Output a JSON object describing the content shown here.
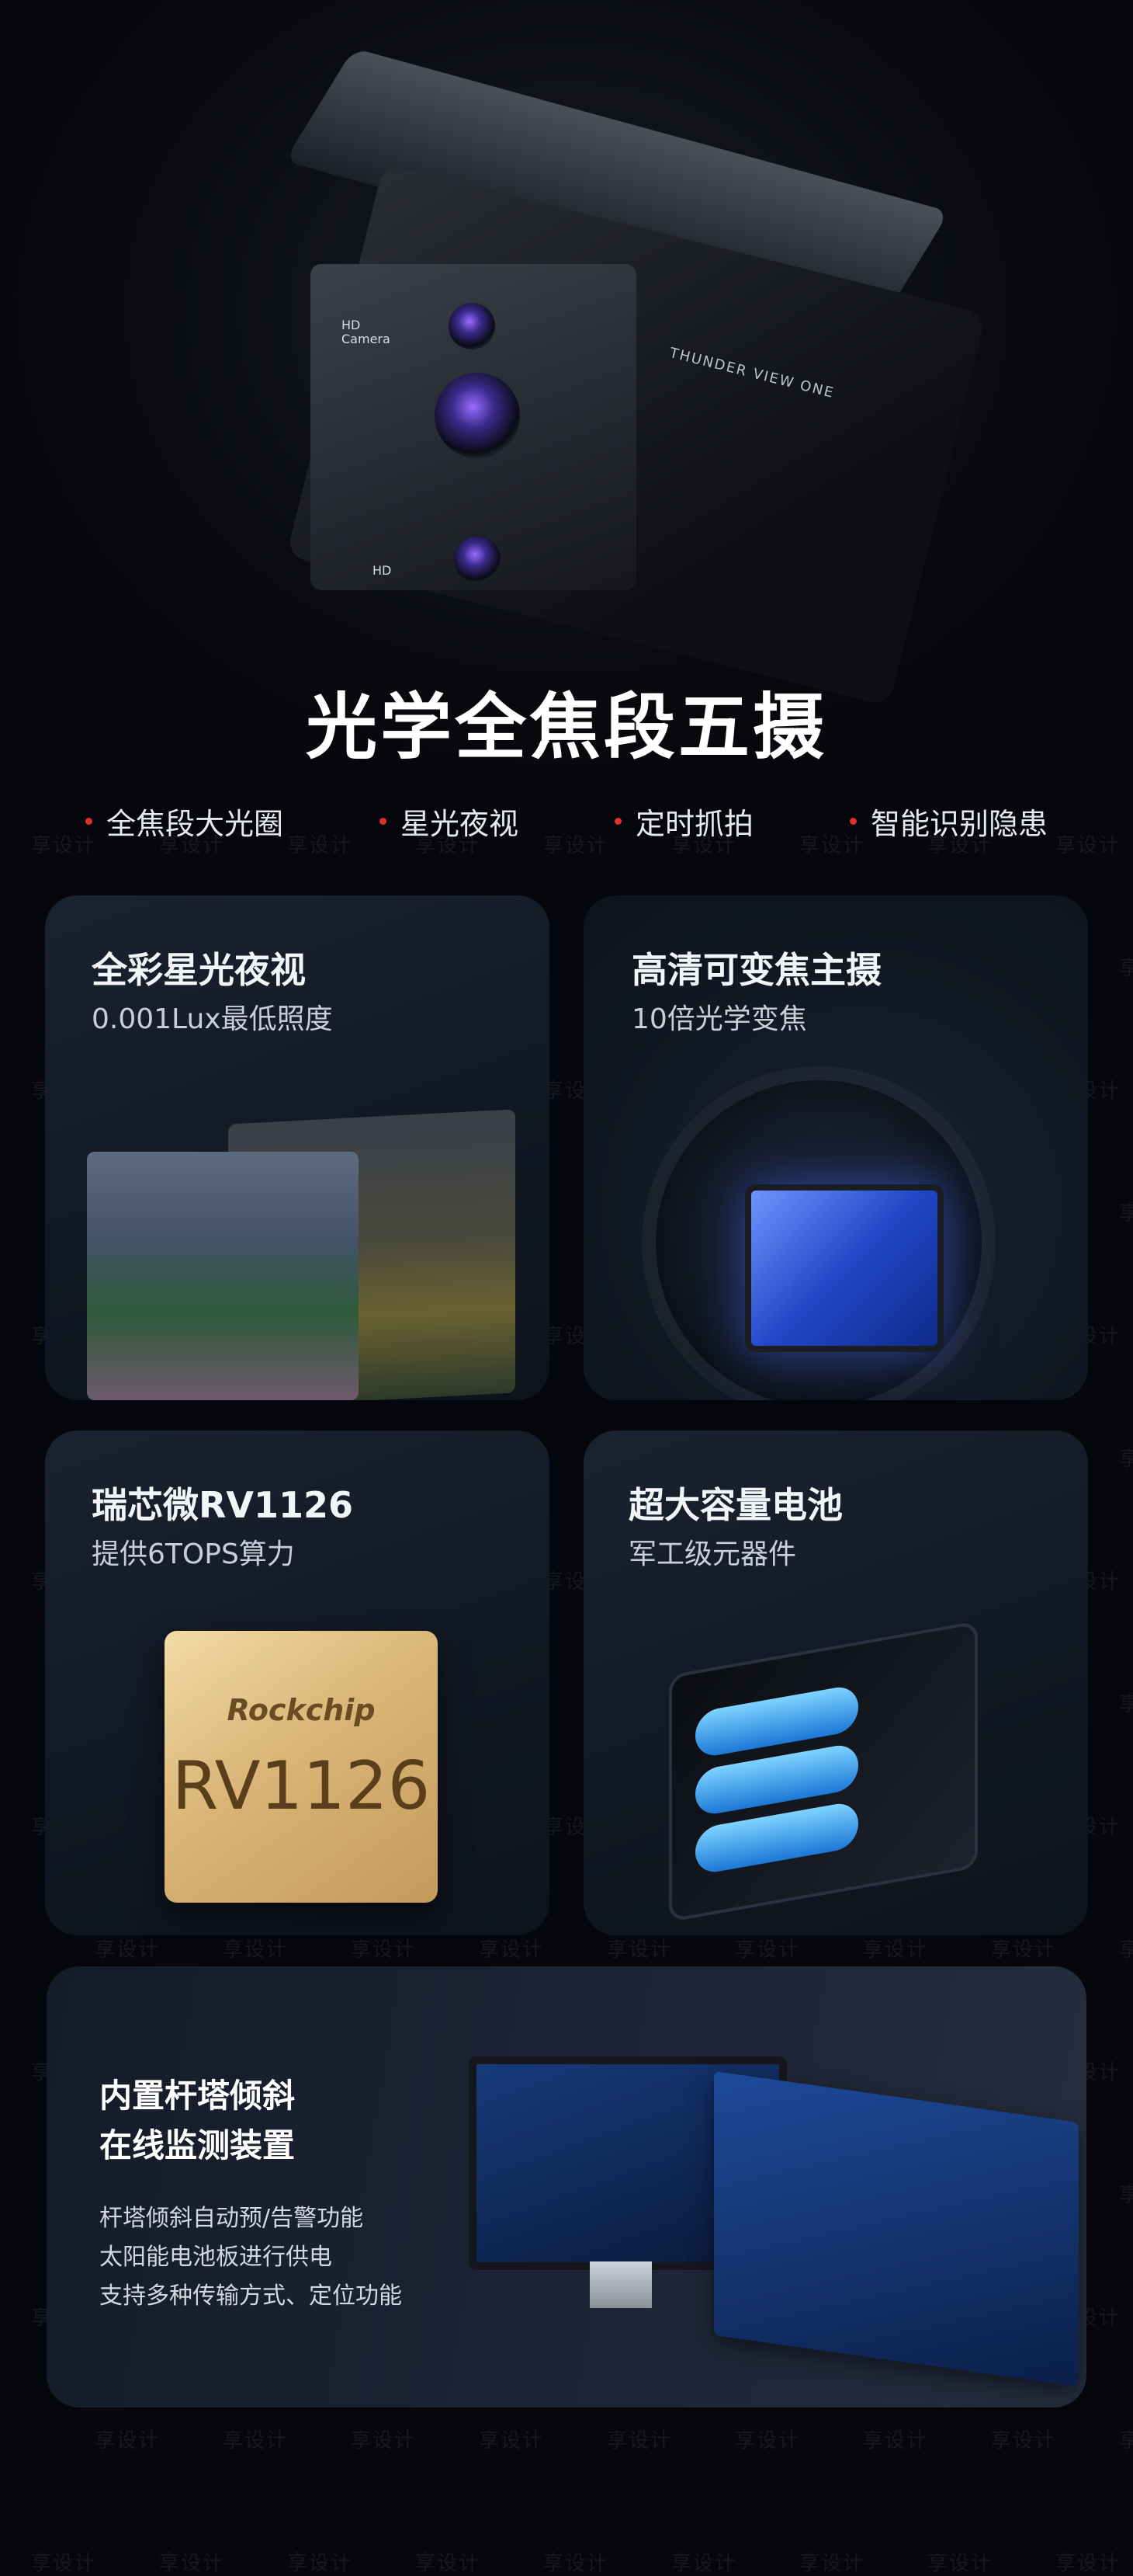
{
  "hero": {
    "title": "光学全焦段五摄",
    "camera_text_hd_top": "HD Camera",
    "camera_text_hd_bottom": "HD",
    "camera_text_brand": "THUNDER VIEW ONE"
  },
  "features": [
    {
      "label": "全焦段大光圈"
    },
    {
      "label": "星光夜视"
    },
    {
      "label": "定时抓拍"
    },
    {
      "label": "智能识别隐患"
    }
  ],
  "cards": {
    "night_vision": {
      "title": "全彩星光夜视",
      "subtitle": "0.001Lux最低照度"
    },
    "zoom": {
      "title": "高清可变焦主摄",
      "subtitle": "10倍光学变焦"
    },
    "chip": {
      "title": "瑞芯微RV1126",
      "subtitle": "提供6TOPS算力",
      "chip_brand": "Rockchip",
      "chip_model": "RV1126"
    },
    "battery": {
      "title": "超大容量电池",
      "subtitle": "军工级元器件"
    },
    "monitor": {
      "title_line1": "内置杆塔倾斜",
      "title_line2": "在线监测装置",
      "lines": [
        "杆塔倾斜自动预/告警功能",
        "太阳能电池板进行供电",
        "支持多种传输方式、定位功能"
      ]
    }
  },
  "watermark": "享设计",
  "colors": {
    "background": "#05070c",
    "card": "#151b26",
    "bullet_dot": "#e0302b",
    "sensor_blue": "#2147c7",
    "chip_gold": "#d9b577"
  }
}
